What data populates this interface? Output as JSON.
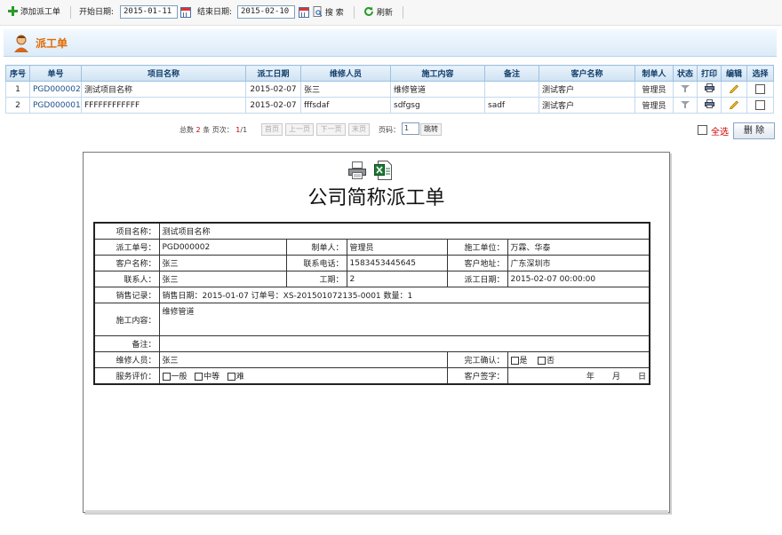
{
  "toolbar": {
    "add_label": "添加派工单",
    "start_label": "开始日期:",
    "start_value": "2015-01-11",
    "end_label": "结束日期:",
    "end_value": "2015-02-10",
    "search_label": "搜 索",
    "refresh_label": "刷新"
  },
  "page": {
    "title": "派工单"
  },
  "table": {
    "headers": [
      "序号",
      "单号",
      "项目名称",
      "派工日期",
      "维修人员",
      "施工内容",
      "备注",
      "客户名称",
      "制单人",
      "状态",
      "打印",
      "编辑",
      "选择"
    ],
    "rows": [
      [
        "1",
        "PGD000002",
        "测试项目名称",
        "2015-02-07",
        "张三",
        "维修管道",
        "",
        "测试客户",
        "管理员"
      ],
      [
        "2",
        "PGD000001",
        "FFFFFFFFFFFF",
        "2015-02-07",
        "fffsdaf",
        "sdfgsg",
        "sadf",
        "测试客户",
        "管理员"
      ]
    ]
  },
  "pager": {
    "total_prefix": "总数",
    "total": "2",
    "total_suffix": "条 页次：",
    "current": "1",
    "of_total": "/1",
    "first": "首页",
    "prev": "上一页",
    "next": "下一页",
    "last": "末页",
    "goto_label": "页码：",
    "goto_value": "1",
    "jump": "跳转"
  },
  "actions": {
    "select_all": "全选",
    "delete": "删 除"
  },
  "doc": {
    "title": "公司简称派工单",
    "labels": {
      "project": "项目名称：",
      "order_no": "派工单号：",
      "creator": "制单人：",
      "unit": "施工单位：",
      "customer": "客户名称：",
      "phone": "联系电话：",
      "address": "客户地址：",
      "contact": "联系人：",
      "period": "工期：",
      "dispatch_date": "派工日期：",
      "sales": "销售记录：",
      "content": "施工内容：",
      "remark": "备注：",
      "repairer": "维修人员：",
      "confirm": "完工确认：",
      "rating": "服务评价：",
      "signature": "客户签字："
    },
    "values": {
      "project": "测试项目名称",
      "order_no": "PGD000002",
      "creator": "管理员",
      "unit": "万霖、华泰",
      "customer": "张三",
      "phone": "1583453445645",
      "address": "广东深圳市",
      "contact": "张三",
      "period": "2",
      "dispatch_date": "2015-02-07 00:00:00",
      "sales": "销售日期：2015-01-07   订单号：XS-201501072135-0001   数量：1",
      "content": "维修管道",
      "remark": "",
      "repairer": "张三",
      "confirm_yes": "是",
      "confirm_no": "否",
      "rating_1": "一般",
      "rating_2": "中等",
      "rating_3": "难",
      "year": "年",
      "month": "月",
      "day": "日"
    }
  },
  "colors": {
    "accent_orange": "#e06a00",
    "header_blue": "#123e6b",
    "link_blue": "#1a4e8a",
    "select_all_red": "#cc0000"
  }
}
